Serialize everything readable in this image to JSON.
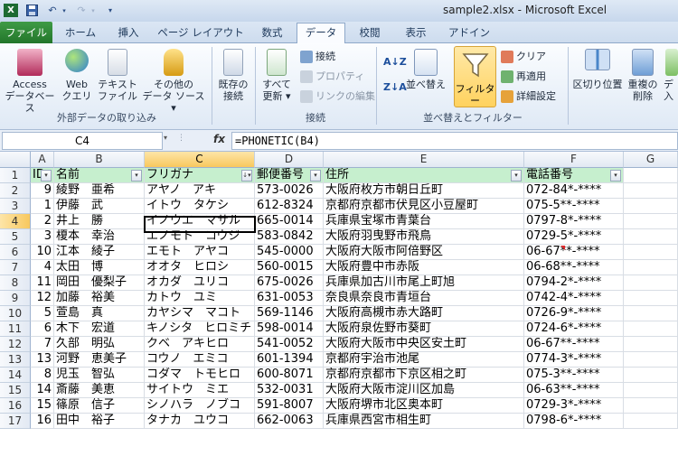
{
  "window": {
    "title": "sample2.xlsx  -  Microsoft Excel"
  },
  "qat": {
    "save_icon": "save-icon",
    "undo_icon": "undo-icon",
    "redo_icon": "redo-icon",
    "customize_icon": "chevron-down-icon"
  },
  "tabs": [
    {
      "label": "ファイル"
    },
    {
      "label": "ホーム"
    },
    {
      "label": "挿入"
    },
    {
      "label": "ページ レイアウト"
    },
    {
      "label": "数式"
    },
    {
      "label": "データ"
    },
    {
      "label": "校閲"
    },
    {
      "label": "表示"
    },
    {
      "label": "アドイン"
    }
  ],
  "ribbon": {
    "external": {
      "access": [
        "Access",
        "データベース"
      ],
      "web": [
        "Web",
        "クエリ"
      ],
      "text": [
        "テキスト",
        "ファイル"
      ],
      "other": [
        "その他の",
        "データ ソース ▾"
      ],
      "existing": [
        "既存の",
        "接続"
      ],
      "group": "外部データの取り込み"
    },
    "connections": {
      "refresh": [
        "すべて",
        "更新 ▾"
      ],
      "connect": "接続",
      "properties": "プロパティ",
      "editlinks": "リンクの編集",
      "group": "接続"
    },
    "sort": {
      "sort": "並べ替え",
      "filter": "フィルター",
      "clear": "クリア",
      "reapply": "再適用",
      "advanced": "詳細設定",
      "group": "並べ替えとフィルター"
    },
    "tools": {
      "textcols": "区切り位置",
      "dupes": [
        "重複の",
        "削除"
      ],
      "partial": [
        "デ",
        "入"
      ]
    }
  },
  "formula_bar": {
    "namebox": "C4",
    "fx": "fx",
    "formula": "=PHONETIC(B4)"
  },
  "columns": [
    "A",
    "B",
    "C",
    "D",
    "E",
    "F",
    "G"
  ],
  "selected": {
    "column": "C",
    "row": 4
  },
  "header_row": [
    "ID",
    "名前",
    "フリガナ",
    "郵便番号",
    "住所",
    "電話番号"
  ],
  "rows": [
    [
      "9",
      "綾野　亜希",
      "アヤノ　アキ",
      "573-0026",
      "大阪府枚方市朝日丘町",
      "072-84*-****"
    ],
    [
      "1",
      "伊藤　武",
      "イトウ　タケシ",
      "612-8324",
      "京都府京都市伏見区小豆屋町",
      "075-5**-****"
    ],
    [
      "2",
      "井上　勝",
      "イノウエ　マサル",
      "665-0014",
      "兵庫県宝塚市青葉台",
      "0797-8*-****"
    ],
    [
      "3",
      "榎本　幸治",
      "エノモト　コウジ",
      "583-0842",
      "大阪府羽曳野市飛鳥",
      "0729-5*-****"
    ],
    [
      "10",
      "江本　綾子",
      "エモト　アヤコ",
      "545-0000",
      "大阪府大阪市阿倍野区",
      "06-67**-****"
    ],
    [
      "4",
      "太田　博",
      "オオタ　ヒロシ",
      "560-0015",
      "大阪府豊中市赤阪",
      "06-68**-****"
    ],
    [
      "11",
      "岡田　優梨子",
      "オカダ　ユリコ",
      "675-0026",
      "兵庫県加古川市尾上町旭",
      "0794-2*-****"
    ],
    [
      "12",
      "加藤　裕美",
      "カトウ　ユミ",
      "631-0053",
      "奈良県奈良市青垣台",
      "0742-4*-****"
    ],
    [
      "5",
      "萱島　真",
      "カヤシマ　マコト",
      "569-1146",
      "大阪府高槻市赤大路町",
      "0726-9*-****"
    ],
    [
      "6",
      "木下　宏道",
      "キノシタ　ヒロミチ",
      "598-0014",
      "大阪府泉佐野市葵町",
      "0724-6*-****"
    ],
    [
      "7",
      "久部　明弘",
      "クベ　アキヒロ",
      "541-0052",
      "大阪府大阪市中央区安土町",
      "06-67**-****"
    ],
    [
      "13",
      "河野　恵美子",
      "コウノ　エミコ",
      "601-1394",
      "京都府宇治市池尾",
      "0774-3*-****"
    ],
    [
      "8",
      "児玉　智弘",
      "コダマ　トモヒロ",
      "600-8071",
      "京都府京都市下京区相之町",
      "075-3**-****"
    ],
    [
      "14",
      "斎藤　美恵",
      "サイトウ　ミエ",
      "532-0031",
      "大阪府大阪市淀川区加島",
      "06-63**-****"
    ],
    [
      "15",
      "篠原　信子",
      "シノハラ　ノブコ",
      "591-8007",
      "大阪府堺市北区奥本町",
      "0729-3*-****"
    ],
    [
      "16",
      "田中　裕子",
      "タナカ　ユウコ",
      "662-0063",
      "兵庫県西宮市相生町",
      "0798-6*-****"
    ]
  ],
  "colors": {
    "header_fill": "#c6efce",
    "file_tab": "#2a7d31",
    "selection": "#f8c85e"
  }
}
